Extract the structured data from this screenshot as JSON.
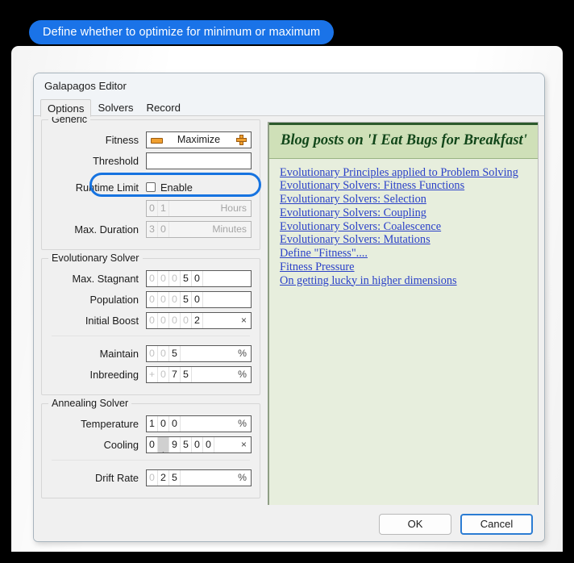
{
  "callout": {
    "text": "Define whether to optimize for minimum or maximum",
    "color": "#1a73e8"
  },
  "dialog": {
    "title": "Galapagos Editor",
    "tabs": [
      {
        "label": "Options",
        "selected": true
      },
      {
        "label": "Solvers",
        "selected": false
      },
      {
        "label": "Record",
        "selected": false
      }
    ]
  },
  "generic": {
    "legend": "Generic",
    "fitness": {
      "label": "Fitness",
      "value": "Maximize",
      "minus_icon": "minus-icon",
      "plus_icon": "plus-icon"
    },
    "threshold": {
      "label": "Threshold",
      "value": ""
    },
    "runtime_limit": {
      "label": "Runtime Limit",
      "checkbox_label": "Enable",
      "checked": false
    },
    "max_duration": {
      "label": "Max. Duration",
      "hours": {
        "digits": [
          "0",
          "1"
        ],
        "dim": [
          true,
          false
        ],
        "unit": "Hours",
        "disabled": true
      },
      "minutes": {
        "digits": [
          "3",
          "0"
        ],
        "dim": [
          false,
          false
        ],
        "unit": "Minutes",
        "disabled": true
      }
    }
  },
  "evolutionary": {
    "legend": "Evolutionary Solver",
    "rows": [
      {
        "label": "Max. Stagnant",
        "digits": [
          "0",
          "0",
          "0",
          "5",
          "0"
        ],
        "dim": [
          true,
          true,
          true,
          false,
          false
        ],
        "unit": ""
      },
      {
        "label": "Population",
        "digits": [
          "0",
          "0",
          "0",
          "5",
          "0"
        ],
        "dim": [
          true,
          true,
          true,
          false,
          false
        ],
        "unit": ""
      },
      {
        "label": "Initial Boost",
        "digits": [
          "0",
          "0",
          "0",
          "0",
          "2"
        ],
        "dim": [
          true,
          true,
          true,
          true,
          false
        ],
        "unit": "×"
      },
      {
        "label": "Maintain",
        "digits": [
          "0",
          "0",
          "5"
        ],
        "dim": [
          true,
          true,
          false
        ],
        "unit": "%"
      },
      {
        "label": "Inbreeding",
        "digits": [
          "+",
          "0",
          "7",
          "5"
        ],
        "dim": [
          true,
          true,
          false,
          false
        ],
        "unit": "%"
      }
    ]
  },
  "annealing": {
    "legend": "Annealing Solver",
    "rows": [
      {
        "label": "Temperature",
        "digits": [
          "1",
          "0",
          "0"
        ],
        "dim": [
          false,
          false,
          false
        ],
        "unit": "%"
      },
      {
        "label": "Cooling",
        "digits": [
          "0",
          ".",
          "9",
          "5",
          "0",
          "0"
        ],
        "dim": [
          false,
          false,
          false,
          false,
          false,
          false
        ],
        "unit": "×"
      },
      {
        "label": "Drift Rate",
        "digits": [
          "0",
          "2",
          "5"
        ],
        "dim": [
          true,
          false,
          false
        ],
        "unit": "%"
      }
    ]
  },
  "blog": {
    "header": "Blog posts on 'I Eat Bugs for Breakfast'",
    "links": [
      "Evolutionary Principles applied to Problem Solving",
      "Evolutionary Solvers: Fitness Functions",
      "Evolutionary Solvers: Selection",
      "Evolutionary Solvers: Coupling",
      "Evolutionary Solvers: Coalescence",
      "Evolutionary Solvers: Mutations",
      "Define \"Fitness\"....",
      "Fitness Pressure",
      "On getting lucky in higher dimensions"
    ],
    "link_color": "#2b41c8",
    "header_bg": "#cfe0b8",
    "body_bg": "#e7eedd"
  },
  "footer": {
    "ok_label": "OK",
    "cancel_label": "Cancel",
    "focused": "cancel"
  }
}
